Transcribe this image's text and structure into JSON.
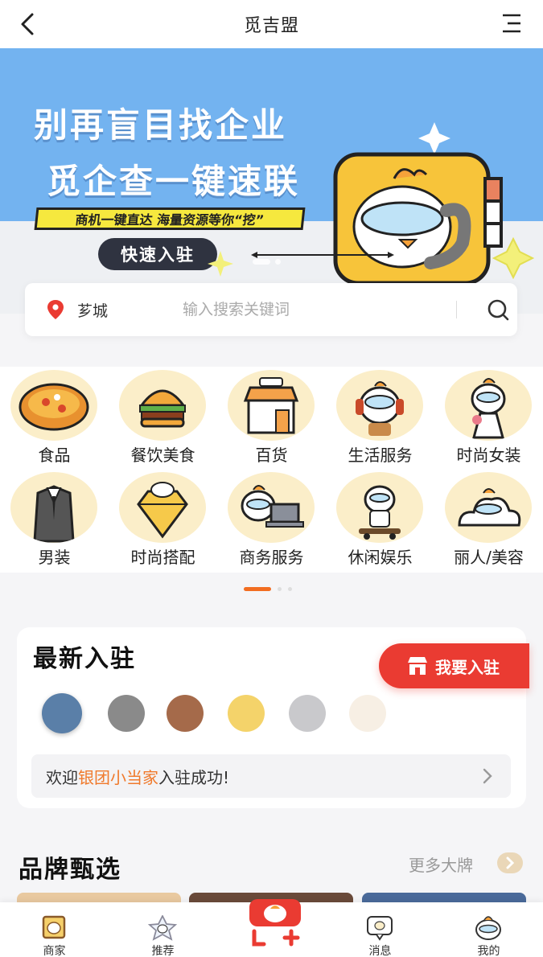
{
  "header": {
    "title": "觅吉盟"
  },
  "banner": {
    "headline_1": "别再盲目找企业",
    "headline_2": "觅企查一键速联",
    "tagline": "商机一键直达 海量资源等你“挖”",
    "cta_label": "快速入驻"
  },
  "search": {
    "city": "芗城",
    "placeholder": "输入搜索关键词"
  },
  "categories": [
    {
      "label": "食品",
      "icon": "pizza-icon"
    },
    {
      "label": "餐饮美食",
      "icon": "burger-icon"
    },
    {
      "label": "百货",
      "icon": "shop-icon"
    },
    {
      "label": "生活服务",
      "icon": "headphone-mascot-icon"
    },
    {
      "label": "时尚女装",
      "icon": "dress-mascot-icon"
    },
    {
      "label": "男装",
      "icon": "suit-icon"
    },
    {
      "label": "时尚搭配",
      "icon": "diamond-icon"
    },
    {
      "label": "商务服务",
      "icon": "laptop-mascot-icon"
    },
    {
      "label": "休闲娱乐",
      "icon": "skateboard-mascot-icon"
    },
    {
      "label": "丽人/美容",
      "icon": "cloud-mascot-icon"
    }
  ],
  "newest": {
    "title": "最新入驻",
    "join_button": "我要入驻",
    "welcome_prefix": "欢迎",
    "welcome_name": "银团小当家",
    "welcome_suffix": "入驻成功!"
  },
  "brands": {
    "title": "品牌甄选",
    "more_label": "更多大牌"
  },
  "tabbar": [
    {
      "label": "商家",
      "icon": "merchant-icon"
    },
    {
      "label": "推荐",
      "icon": "recommend-icon"
    },
    {
      "label": "",
      "icon": "publish-plus-icon"
    },
    {
      "label": "消息",
      "icon": "message-icon"
    },
    {
      "label": "我的",
      "icon": "profile-icon"
    }
  ],
  "colors": {
    "accent": "#f26d21",
    "join_red": "#ea3b32",
    "banner_blue": "#73b3f0",
    "highlight": "#f07a2c"
  }
}
